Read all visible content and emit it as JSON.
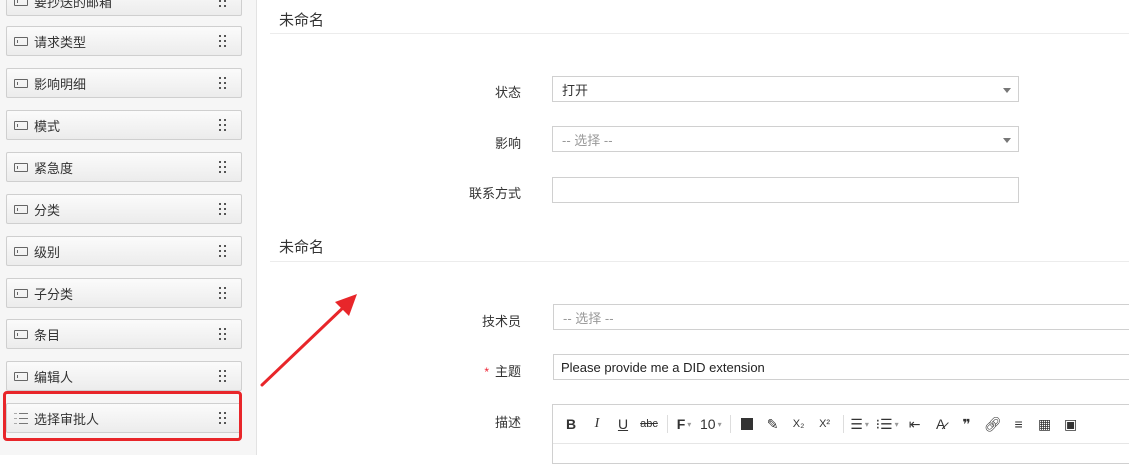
{
  "sidebar": {
    "items": [
      {
        "label": "要抄送的邮箱"
      },
      {
        "label": "请求类型"
      },
      {
        "label": "影响明细"
      },
      {
        "label": "模式"
      },
      {
        "label": "紧急度"
      },
      {
        "label": "分类"
      },
      {
        "label": "级别"
      },
      {
        "label": "子分类"
      },
      {
        "label": "条目"
      },
      {
        "label": "编辑人"
      },
      {
        "label": "选择审批人"
      }
    ],
    "highlight_color": "#e8262a"
  },
  "sections": [
    {
      "title": "未命名"
    },
    {
      "title": "未命名"
    }
  ],
  "form": {
    "status": {
      "label": "状态",
      "value": "打开"
    },
    "impact": {
      "label": "影响",
      "placeholder": "-- 选择 --"
    },
    "contact": {
      "label": "联系方式",
      "value": ""
    },
    "technician": {
      "label": "技术员",
      "placeholder": "-- 选择 --"
    },
    "subject": {
      "label": "主题",
      "required_mark": "*",
      "value": "Please provide me a DID extension"
    },
    "description": {
      "label": "描述"
    }
  },
  "toolbar": {
    "bold": "B",
    "italic": "I",
    "underline": "U",
    "strike": "abc",
    "font_family": "F",
    "font_size": "10",
    "subscript": "X₂",
    "superscript": "X²",
    "quote": "❞"
  }
}
